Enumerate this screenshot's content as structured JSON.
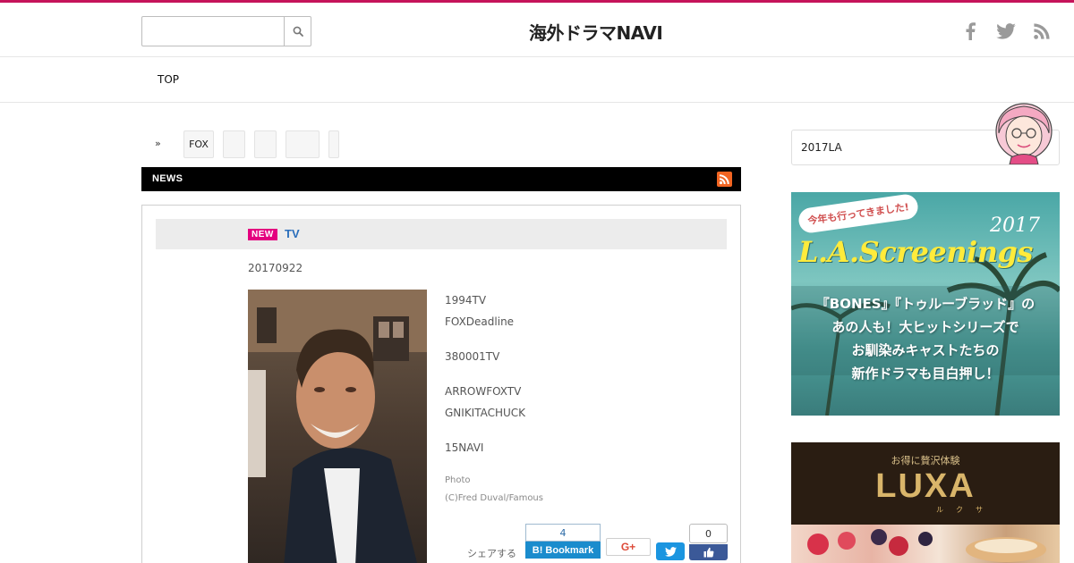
{
  "header": {
    "search_placeholder": "",
    "logo_text": "海外ドラマNAVI"
  },
  "nav": {
    "items": [
      "TOP"
    ]
  },
  "breadcrumb": {
    "separator": "»",
    "tags": [
      "FOX",
      "",
      "",
      "",
      ""
    ]
  },
  "section": {
    "label": "NEWS"
  },
  "article": {
    "badge": "NEW",
    "title": "TV",
    "date": "20170922",
    "paragraphs": [
      "1994TV",
      "FOXDeadline",
      "380001TV",
      "ARROWFOXTV",
      "GNIKITACHUCK",
      "15NAVI"
    ],
    "caption_label": "Photo",
    "caption_credit": "(C)Fred Duval/Famous"
  },
  "share": {
    "label": "シェアする",
    "hatena_count": "4",
    "hatena_label": "Bookmark",
    "hatena_icon_text": "B!",
    "gplus_label": "G+",
    "facebook_count": "0"
  },
  "sidebar": {
    "box_text": "2017LA",
    "ad1": {
      "bubble": "今年も行ってきました!",
      "year": "2017",
      "title": "L.A.Screenings",
      "lines": [
        "『BONES』『トゥルーブラッド』の",
        "あの人も！大ヒットシリーズで",
        "お馴染みキャストたちの",
        "新作ドラマも目白押し！"
      ]
    },
    "ad2": {
      "top": "お得に贅沢体験",
      "logo": "LUXA",
      "ruby": "ルクサ"
    }
  },
  "colors": {
    "accent": "#c5135a",
    "new_badge": "#e4007f",
    "link": "#2a6ebb",
    "rss": "#f26522",
    "hatena": "#1a8ccd",
    "twitter": "#1b95e0",
    "facebook": "#3b5998"
  },
  "icons": {
    "search": "search-icon",
    "facebook": "facebook-icon",
    "twitter": "twitter-icon",
    "rss": "rss-icon"
  }
}
